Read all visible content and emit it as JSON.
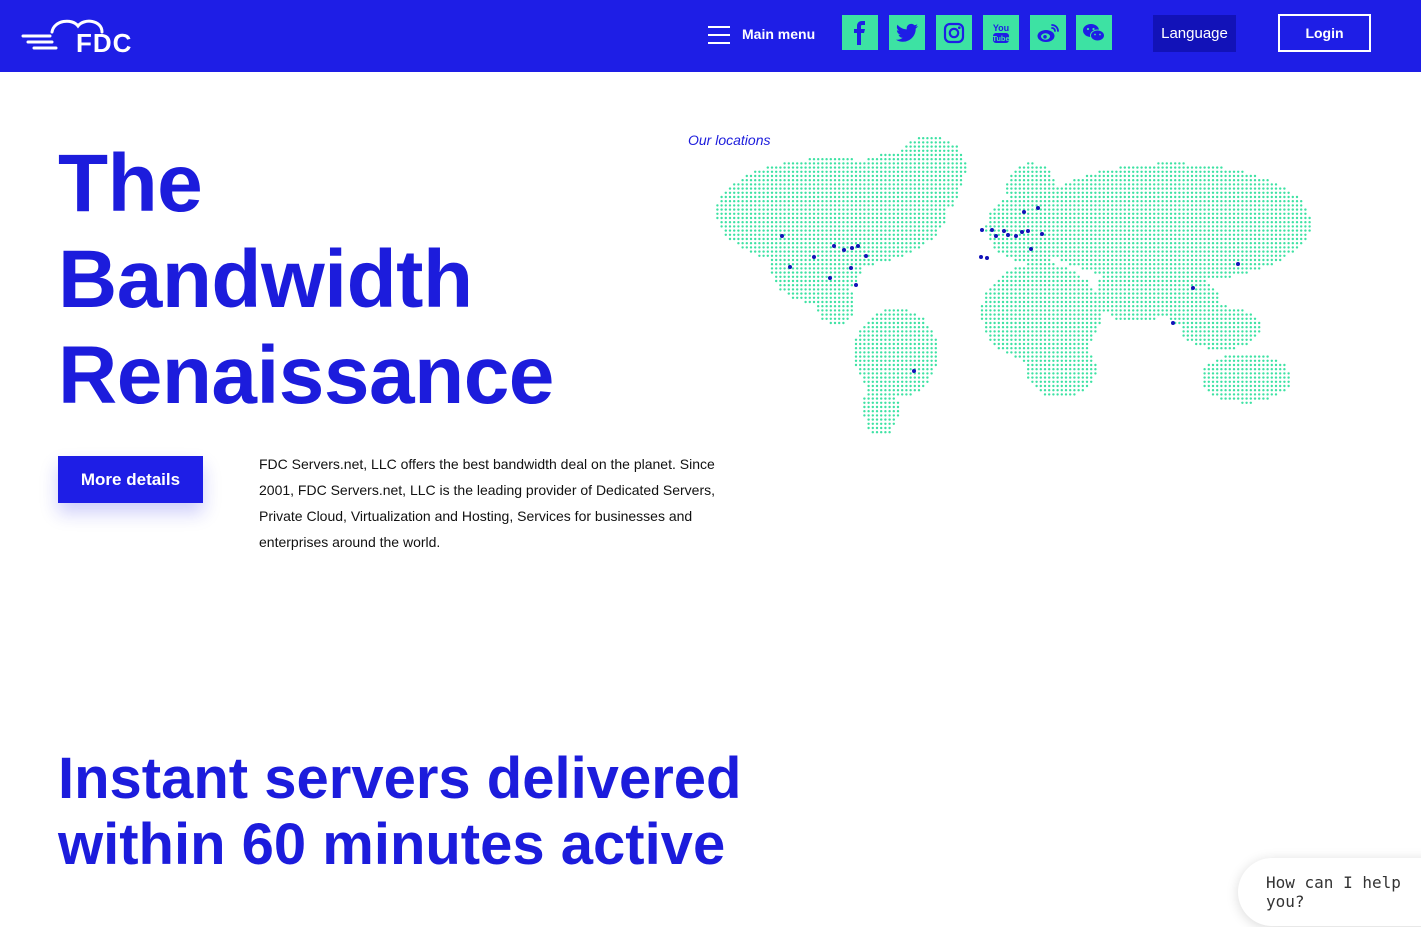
{
  "header": {
    "logo_text": "FDC",
    "menu_label": "Main menu",
    "social": [
      {
        "name": "facebook-icon"
      },
      {
        "name": "twitter-icon"
      },
      {
        "name": "instagram-icon"
      },
      {
        "name": "youtube-icon"
      },
      {
        "name": "weibo-icon"
      },
      {
        "name": "wechat-icon"
      }
    ],
    "language_label": "Language",
    "login_label": "Login"
  },
  "hero": {
    "title_line1": "The",
    "title_line2": "Bandwidth",
    "title_line3": "Renaissance",
    "button_label": "More details",
    "description": "FDC Servers.net, LLC offers the best bandwidth deal on the planet. Since 2001, FDC Servers.net, LLC is the leading provider of Dedicated Servers, Private Cloud, Virtualization and Hosting, Services for businesses and enterprises around the world."
  },
  "map": {
    "caption": "Our locations"
  },
  "section": {
    "title_line1": "Instant servers delivered",
    "title_line2": "within 60 minutes active"
  },
  "chat": {
    "prompt": "How can I help you?"
  },
  "colors": {
    "brand_blue": "#1e1ee6",
    "accent_green": "#3de2a3",
    "map_dot": "#3de2a3",
    "location_dot": "#1212b8"
  }
}
